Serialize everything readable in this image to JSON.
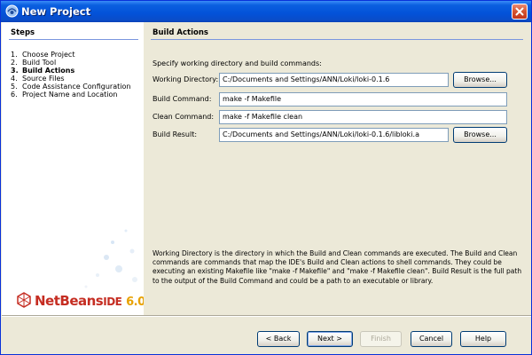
{
  "window": {
    "title": "New Project"
  },
  "steps": {
    "title": "Steps",
    "items": [
      {
        "num": "1.",
        "label": "Choose Project"
      },
      {
        "num": "2.",
        "label": "Build Tool"
      },
      {
        "num": "3.",
        "label": "Build Actions"
      },
      {
        "num": "4.",
        "label": "Source Files"
      },
      {
        "num": "5.",
        "label": "Code Assistance Configuration"
      },
      {
        "num": "6.",
        "label": "Project Name and Location"
      }
    ],
    "active_index": 2
  },
  "logo": {
    "brand": "NetBeans",
    "ide": "IDE",
    "version": "6.0"
  },
  "main": {
    "title": "Build Actions",
    "intro": "Specify working directory and build commands:",
    "working_directory": {
      "label": "Working Directory:",
      "value": "C:/Documents and Settings/ANN/Loki/loki-0.1.6",
      "browse": "Browse..."
    },
    "build_command": {
      "label": "Build Command:",
      "value": "make -f Makefile"
    },
    "clean_command": {
      "label": "Clean Command:",
      "value": "make -f Makefile clean"
    },
    "build_result": {
      "label": "Build Result:",
      "value": "C:/Documents and Settings/ANN/Loki/loki-0.1.6/libloki.a",
      "browse": "Browse..."
    },
    "help": "Working Directory is the directory in which the Build and Clean commands are executed. The Build and Clean commands are commands that map the IDE's Build and Clean actions to shell commands. They could be executing an existing Makefile like \"make -f Makefile\" and \"make -f Makefile clean\". Build Result is the full path to the output of the Build Command and could be a path to an executable or library."
  },
  "buttons": {
    "back": "< Back",
    "next": "Next >",
    "finish": "Finish",
    "cancel": "Cancel",
    "help": "Help"
  },
  "colors": {
    "title_bar": "#0352d8",
    "brand_red": "#c52d22",
    "brand_orange": "#e8a100",
    "section_rule": "#7a96df"
  }
}
